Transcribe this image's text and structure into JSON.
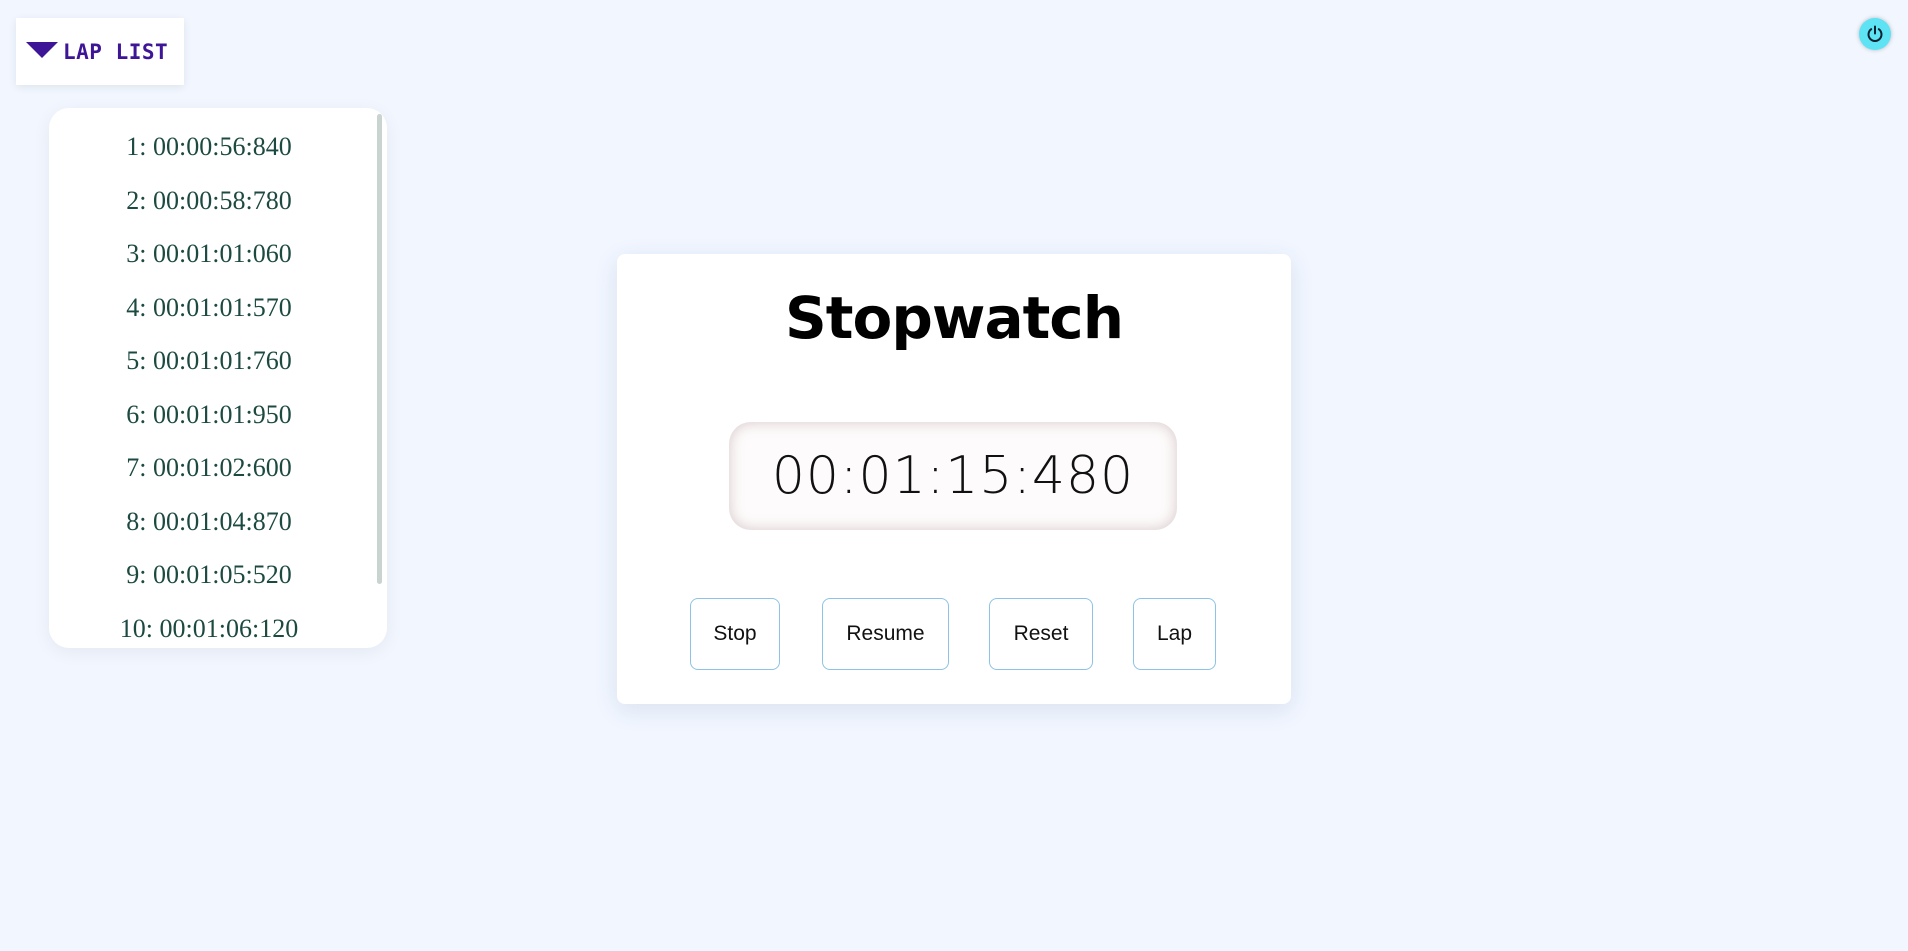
{
  "lap_toggle": {
    "label": "LAP LIST"
  },
  "laps": [
    "1: 00:00:56:840",
    "2: 00:00:58:780",
    "3: 00:01:01:060",
    "4: 00:01:01:570",
    "5: 00:01:01:760",
    "6: 00:01:01:950",
    "7: 00:01:02:600",
    "8: 00:01:04:870",
    "9: 00:01:05:520",
    "10: 00:01:06:120"
  ],
  "stopwatch": {
    "title": "Stopwatch",
    "time": "00:01:15:480",
    "buttons": {
      "stop": "Stop",
      "resume": "Resume",
      "reset": "Reset",
      "lap": "Lap"
    }
  },
  "colors": {
    "background": "#f1f6ff",
    "lap_toggle_accent": "#3d1596",
    "lap_text": "#1c4a40",
    "power_button": "#5de3f3",
    "button_border": "#8cc3e6"
  },
  "icons": {
    "power": "power-icon",
    "toggle": "triangle-down-icon"
  }
}
